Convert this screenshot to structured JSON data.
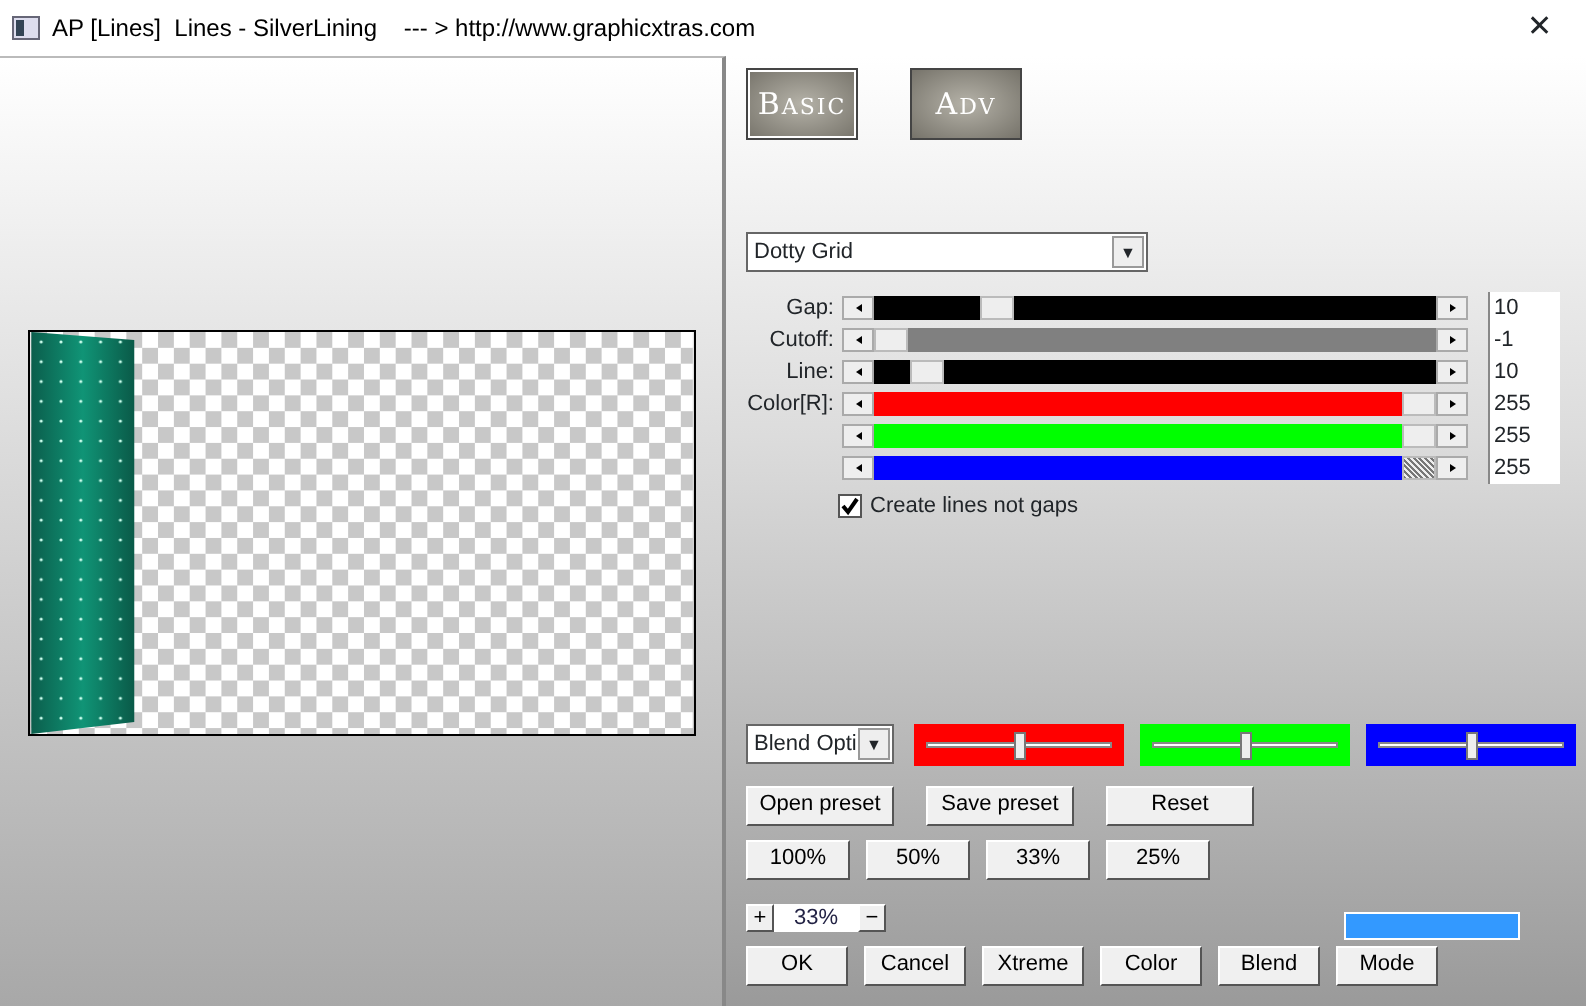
{
  "window": {
    "title": "AP [Lines]  Lines - SilverLining    --- > http://www.graphicxtras.com",
    "close": "✕"
  },
  "preview": {
    "kind": "picture"
  },
  "tabs": [
    {
      "label": "Basic",
      "selected": true
    },
    {
      "label": "Adv",
      "selected": false
    }
  ],
  "preset": {
    "value": "Dotty Grid",
    "arrow": "▼"
  },
  "sliders": [
    {
      "label": "Gap:",
      "level": 0.2,
      "value": "10",
      "color": "#000000"
    },
    {
      "label": "Cutoff:",
      "level": 0,
      "value": "-1",
      "color": "#808080"
    },
    {
      "label": "Line:",
      "level": 0.07,
      "value": "10",
      "color": "#000000"
    },
    {
      "label": "Color[R]:",
      "level": 1,
      "value": "255",
      "color": "#ff0000"
    },
    {
      "level": 1,
      "value": "255",
      "color": "#00ff00"
    },
    {
      "level": 1,
      "value": "255",
      "color": "#0000ff"
    }
  ],
  "checkbox": {
    "label": "Create lines not gaps",
    "checked": true
  },
  "blend": {
    "value": "Blend Opti",
    "arrow": "▼"
  },
  "channel_sliders": [
    {
      "color": "#ff0000",
      "level": 0.5
    },
    {
      "color": "#00ff00",
      "level": 0.5
    },
    {
      "color": "#0000ff",
      "level": 0.5
    }
  ],
  "preset_buttons": [
    "Open preset",
    "Save preset",
    "Reset"
  ],
  "zoom_buttons": [
    "100%",
    "50%",
    "33%",
    "25%"
  ],
  "zoom": {
    "plus": "+",
    "value": "33%",
    "minus": "−"
  },
  "swatch": {
    "color": "#3399ff"
  },
  "buttons": [
    "OK",
    "Cancel",
    "Xtreme",
    "Color",
    "Blend",
    "Mode"
  ]
}
